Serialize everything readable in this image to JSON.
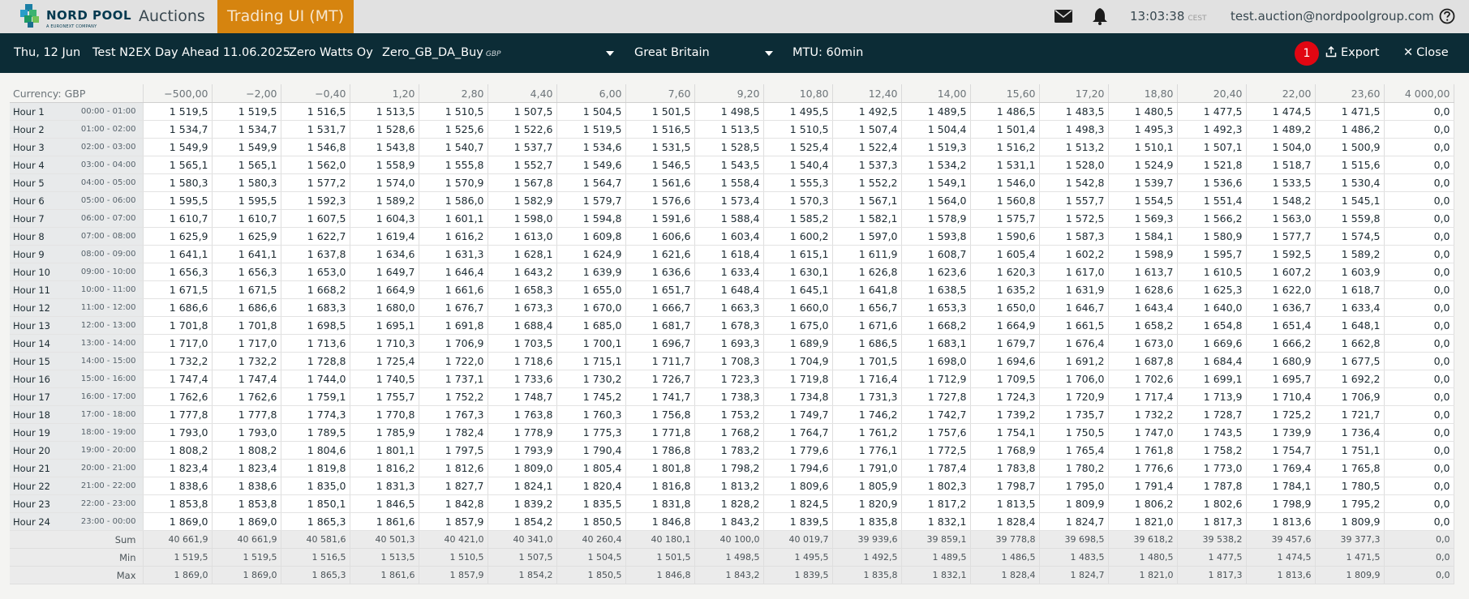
{
  "header": {
    "logo_text": "NORD POOL",
    "logo_subtitle": "A EURONEXT COMPANY",
    "nav": [
      {
        "label": "Auctions",
        "active": false
      },
      {
        "label": "Trading UI (MT)",
        "active": true
      }
    ],
    "clock": "13:03:38",
    "timezone": "CEST",
    "user_email": "test.auction@nordpoolgroup.com",
    "icons": [
      "mail-icon",
      "bell-icon",
      "help-icon"
    ]
  },
  "subbar": {
    "date": "Thu, 12 Jun",
    "auction": "Test N2EX Day Ahead 11.06.2025",
    "company": "Zero Watts Oy",
    "portfolio": "Zero_GB_DA_Buy",
    "portfolio_currency": "GBP",
    "area": "Great Britain",
    "mtu": "MTU: 60min",
    "notification_count": "1",
    "export_label": "Export",
    "close_label": "Close"
  },
  "colors": {
    "accent": "#d6840f",
    "header_dark": "#0c2c36",
    "badge": "#e10612"
  },
  "grid": {
    "currency_label": "Currency: GBP",
    "price_columns": [
      "−500,00",
      "−2,00",
      "−0,40",
      "1,20",
      "2,80",
      "4,40",
      "6,00",
      "7,60",
      "9,20",
      "10,80",
      "12,40",
      "14,00",
      "15,60",
      "17,20",
      "18,80",
      "20,40",
      "22,00",
      "23,60",
      "4 000,00"
    ],
    "rows": [
      {
        "hour": "Hour 1",
        "time": "00:00 - 01:00",
        "values": [
          "1 519,5",
          "1 519,5",
          "1 516,5",
          "1 513,5",
          "1 510,5",
          "1 507,5",
          "1 504,5",
          "1 501,5",
          "1 498,5",
          "1 495,5",
          "1 492,5",
          "1 489,5",
          "1 486,5",
          "1 483,5",
          "1 480,5",
          "1 477,5",
          "1 474,5",
          "1 471,5",
          "0,0"
        ]
      },
      {
        "hour": "Hour 2",
        "time": "01:00 - 02:00",
        "values": [
          "1 534,7",
          "1 534,7",
          "1 531,7",
          "1 528,6",
          "1 525,6",
          "1 522,6",
          "1 519,5",
          "1 516,5",
          "1 513,5",
          "1 510,5",
          "1 507,4",
          "1 504,4",
          "1 501,4",
          "1 498,3",
          "1 495,3",
          "1 492,3",
          "1 489,2",
          "1 486,2",
          "0,0"
        ]
      },
      {
        "hour": "Hour 3",
        "time": "02:00 - 03:00",
        "values": [
          "1 549,9",
          "1 549,9",
          "1 546,8",
          "1 543,8",
          "1 540,7",
          "1 537,7",
          "1 534,6",
          "1 531,5",
          "1 528,5",
          "1 525,4",
          "1 522,4",
          "1 519,3",
          "1 516,2",
          "1 513,2",
          "1 510,1",
          "1 507,1",
          "1 504,0",
          "1 500,9",
          "0,0"
        ]
      },
      {
        "hour": "Hour 4",
        "time": "03:00 - 04:00",
        "values": [
          "1 565,1",
          "1 565,1",
          "1 562,0",
          "1 558,9",
          "1 555,8",
          "1 552,7",
          "1 549,6",
          "1 546,5",
          "1 543,5",
          "1 540,4",
          "1 537,3",
          "1 534,2",
          "1 531,1",
          "1 528,0",
          "1 524,9",
          "1 521,8",
          "1 518,7",
          "1 515,6",
          "0,0"
        ]
      },
      {
        "hour": "Hour 5",
        "time": "04:00 - 05:00",
        "values": [
          "1 580,3",
          "1 580,3",
          "1 577,2",
          "1 574,0",
          "1 570,9",
          "1 567,8",
          "1 564,7",
          "1 561,6",
          "1 558,4",
          "1 555,3",
          "1 552,2",
          "1 549,1",
          "1 546,0",
          "1 542,8",
          "1 539,7",
          "1 536,6",
          "1 533,5",
          "1 530,4",
          "0,0"
        ]
      },
      {
        "hour": "Hour 6",
        "time": "05:00 - 06:00",
        "values": [
          "1 595,5",
          "1 595,5",
          "1 592,3",
          "1 589,2",
          "1 586,0",
          "1 582,9",
          "1 579,7",
          "1 576,6",
          "1 573,4",
          "1 570,3",
          "1 567,1",
          "1 564,0",
          "1 560,8",
          "1 557,7",
          "1 554,5",
          "1 551,4",
          "1 548,2",
          "1 545,1",
          "0,0"
        ]
      },
      {
        "hour": "Hour 7",
        "time": "06:00 - 07:00",
        "values": [
          "1 610,7",
          "1 610,7",
          "1 607,5",
          "1 604,3",
          "1 601,1",
          "1 598,0",
          "1 594,8",
          "1 591,6",
          "1 588,4",
          "1 585,2",
          "1 582,1",
          "1 578,9",
          "1 575,7",
          "1 572,5",
          "1 569,3",
          "1 566,2",
          "1 563,0",
          "1 559,8",
          "0,0"
        ]
      },
      {
        "hour": "Hour 8",
        "time": "07:00 - 08:00",
        "values": [
          "1 625,9",
          "1 625,9",
          "1 622,7",
          "1 619,4",
          "1 616,2",
          "1 613,0",
          "1 609,8",
          "1 606,6",
          "1 603,4",
          "1 600,2",
          "1 597,0",
          "1 593,8",
          "1 590,6",
          "1 587,3",
          "1 584,1",
          "1 580,9",
          "1 577,7",
          "1 574,5",
          "0,0"
        ]
      },
      {
        "hour": "Hour 9",
        "time": "08:00 - 09:00",
        "values": [
          "1 641,1",
          "1 641,1",
          "1 637,8",
          "1 634,6",
          "1 631,3",
          "1 628,1",
          "1 624,9",
          "1 621,6",
          "1 618,4",
          "1 615,1",
          "1 611,9",
          "1 608,7",
          "1 605,4",
          "1 602,2",
          "1 598,9",
          "1 595,7",
          "1 592,5",
          "1 589,2",
          "0,0"
        ]
      },
      {
        "hour": "Hour 10",
        "time": "09:00 - 10:00",
        "values": [
          "1 656,3",
          "1 656,3",
          "1 653,0",
          "1 649,7",
          "1 646,4",
          "1 643,2",
          "1 639,9",
          "1 636,6",
          "1 633,4",
          "1 630,1",
          "1 626,8",
          "1 623,6",
          "1 620,3",
          "1 617,0",
          "1 613,7",
          "1 610,5",
          "1 607,2",
          "1 603,9",
          "0,0"
        ]
      },
      {
        "hour": "Hour 11",
        "time": "10:00 - 11:00",
        "values": [
          "1 671,5",
          "1 671,5",
          "1 668,2",
          "1 664,9",
          "1 661,6",
          "1 658,3",
          "1 655,0",
          "1 651,7",
          "1 648,4",
          "1 645,1",
          "1 641,8",
          "1 638,5",
          "1 635,2",
          "1 631,9",
          "1 628,6",
          "1 625,3",
          "1 622,0",
          "1 618,7",
          "0,0"
        ]
      },
      {
        "hour": "Hour 12",
        "time": "11:00 - 12:00",
        "values": [
          "1 686,6",
          "1 686,6",
          "1 683,3",
          "1 680,0",
          "1 676,7",
          "1 673,3",
          "1 670,0",
          "1 666,7",
          "1 663,3",
          "1 660,0",
          "1 656,7",
          "1 653,3",
          "1 650,0",
          "1 646,7",
          "1 643,4",
          "1 640,0",
          "1 636,7",
          "1 633,4",
          "0,0"
        ]
      },
      {
        "hour": "Hour 13",
        "time": "12:00 - 13:00",
        "values": [
          "1 701,8",
          "1 701,8",
          "1 698,5",
          "1 695,1",
          "1 691,8",
          "1 688,4",
          "1 685,0",
          "1 681,7",
          "1 678,3",
          "1 675,0",
          "1 671,6",
          "1 668,2",
          "1 664,9",
          "1 661,5",
          "1 658,2",
          "1 654,8",
          "1 651,4",
          "1 648,1",
          "0,0"
        ]
      },
      {
        "hour": "Hour 14",
        "time": "13:00 - 14:00",
        "values": [
          "1 717,0",
          "1 717,0",
          "1 713,6",
          "1 710,3",
          "1 706,9",
          "1 703,5",
          "1 700,1",
          "1 696,7",
          "1 693,3",
          "1 689,9",
          "1 686,5",
          "1 683,1",
          "1 679,7",
          "1 676,4",
          "1 673,0",
          "1 669,6",
          "1 666,2",
          "1 662,8",
          "0,0"
        ]
      },
      {
        "hour": "Hour 15",
        "time": "14:00 - 15:00",
        "values": [
          "1 732,2",
          "1 732,2",
          "1 728,8",
          "1 725,4",
          "1 722,0",
          "1 718,6",
          "1 715,1",
          "1 711,7",
          "1 708,3",
          "1 704,9",
          "1 701,5",
          "1 698,0",
          "1 694,6",
          "1 691,2",
          "1 687,8",
          "1 684,4",
          "1 680,9",
          "1 677,5",
          "0,0"
        ]
      },
      {
        "hour": "Hour 16",
        "time": "15:00 - 16:00",
        "values": [
          "1 747,4",
          "1 747,4",
          "1 744,0",
          "1 740,5",
          "1 737,1",
          "1 733,6",
          "1 730,2",
          "1 726,7",
          "1 723,3",
          "1 719,8",
          "1 716,4",
          "1 712,9",
          "1 709,5",
          "1 706,0",
          "1 702,6",
          "1 699,1",
          "1 695,7",
          "1 692,2",
          "0,0"
        ]
      },
      {
        "hour": "Hour 17",
        "time": "16:00 - 17:00",
        "values": [
          "1 762,6",
          "1 762,6",
          "1 759,1",
          "1 755,7",
          "1 752,2",
          "1 748,7",
          "1 745,2",
          "1 741,7",
          "1 738,3",
          "1 734,8",
          "1 731,3",
          "1 727,8",
          "1 724,3",
          "1 720,9",
          "1 717,4",
          "1 713,9",
          "1 710,4",
          "1 706,9",
          "0,0"
        ]
      },
      {
        "hour": "Hour 18",
        "time": "17:00 - 18:00",
        "values": [
          "1 777,8",
          "1 777,8",
          "1 774,3",
          "1 770,8",
          "1 767,3",
          "1 763,8",
          "1 760,3",
          "1 756,8",
          "1 753,2",
          "1 749,7",
          "1 746,2",
          "1 742,7",
          "1 739,2",
          "1 735,7",
          "1 732,2",
          "1 728,7",
          "1 725,2",
          "1 721,7",
          "0,0"
        ]
      },
      {
        "hour": "Hour 19",
        "time": "18:00 - 19:00",
        "values": [
          "1 793,0",
          "1 793,0",
          "1 789,5",
          "1 785,9",
          "1 782,4",
          "1 778,9",
          "1 775,3",
          "1 771,8",
          "1 768,2",
          "1 764,7",
          "1 761,2",
          "1 757,6",
          "1 754,1",
          "1 750,5",
          "1 747,0",
          "1 743,5",
          "1 739,9",
          "1 736,4",
          "0,0"
        ]
      },
      {
        "hour": "Hour 20",
        "time": "19:00 - 20:00",
        "values": [
          "1 808,2",
          "1 808,2",
          "1 804,6",
          "1 801,1",
          "1 797,5",
          "1 793,9",
          "1 790,4",
          "1 786,8",
          "1 783,2",
          "1 779,6",
          "1 776,1",
          "1 772,5",
          "1 768,9",
          "1 765,4",
          "1 761,8",
          "1 758,2",
          "1 754,7",
          "1 751,1",
          "0,0"
        ]
      },
      {
        "hour": "Hour 21",
        "time": "20:00 - 21:00",
        "values": [
          "1 823,4",
          "1 823,4",
          "1 819,8",
          "1 816,2",
          "1 812,6",
          "1 809,0",
          "1 805,4",
          "1 801,8",
          "1 798,2",
          "1 794,6",
          "1 791,0",
          "1 787,4",
          "1 783,8",
          "1 780,2",
          "1 776,6",
          "1 773,0",
          "1 769,4",
          "1 765,8",
          "0,0"
        ]
      },
      {
        "hour": "Hour 22",
        "time": "21:00 - 22:00",
        "values": [
          "1 838,6",
          "1 838,6",
          "1 835,0",
          "1 831,3",
          "1 827,7",
          "1 824,1",
          "1 820,4",
          "1 816,8",
          "1 813,2",
          "1 809,6",
          "1 805,9",
          "1 802,3",
          "1 798,7",
          "1 795,0",
          "1 791,4",
          "1 787,8",
          "1 784,1",
          "1 780,5",
          "0,0"
        ]
      },
      {
        "hour": "Hour 23",
        "time": "22:00 - 23:00",
        "values": [
          "1 853,8",
          "1 853,8",
          "1 850,1",
          "1 846,5",
          "1 842,8",
          "1 839,2",
          "1 835,5",
          "1 831,8",
          "1 828,2",
          "1 824,5",
          "1 820,9",
          "1 817,2",
          "1 813,5",
          "1 809,9",
          "1 806,2",
          "1 802,6",
          "1 798,9",
          "1 795,2",
          "0,0"
        ]
      },
      {
        "hour": "Hour 24",
        "time": "23:00 - 00:00",
        "values": [
          "1 869,0",
          "1 869,0",
          "1 865,3",
          "1 861,6",
          "1 857,9",
          "1 854,2",
          "1 850,5",
          "1 846,8",
          "1 843,2",
          "1 839,5",
          "1 835,8",
          "1 832,1",
          "1 828,4",
          "1 824,7",
          "1 821,0",
          "1 817,3",
          "1 813,6",
          "1 809,9",
          "0,0"
        ]
      }
    ],
    "summary": [
      {
        "label": "Sum",
        "values": [
          "40 661,9",
          "40 661,9",
          "40 581,6",
          "40 501,3",
          "40 421,0",
          "40 341,0",
          "40 260,4",
          "40 180,1",
          "40 100,0",
          "40 019,7",
          "39 939,6",
          "39 859,1",
          "39 778,8",
          "39 698,5",
          "39 618,2",
          "39 538,2",
          "39 457,6",
          "39 377,3",
          "0,0"
        ]
      },
      {
        "label": "Min",
        "values": [
          "1 519,5",
          "1 519,5",
          "1 516,5",
          "1 513,5",
          "1 510,5",
          "1 507,5",
          "1 504,5",
          "1 501,5",
          "1 498,5",
          "1 495,5",
          "1 492,5",
          "1 489,5",
          "1 486,5",
          "1 483,5",
          "1 480,5",
          "1 477,5",
          "1 474,5",
          "1 471,5",
          "0,0"
        ]
      },
      {
        "label": "Max",
        "values": [
          "1 869,0",
          "1 869,0",
          "1 865,3",
          "1 861,6",
          "1 857,9",
          "1 854,2",
          "1 850,5",
          "1 846,8",
          "1 843,2",
          "1 839,5",
          "1 835,8",
          "1 832,1",
          "1 828,4",
          "1 824,7",
          "1 821,0",
          "1 817,3",
          "1 813,6",
          "1 809,9",
          "0,0"
        ]
      }
    ]
  }
}
